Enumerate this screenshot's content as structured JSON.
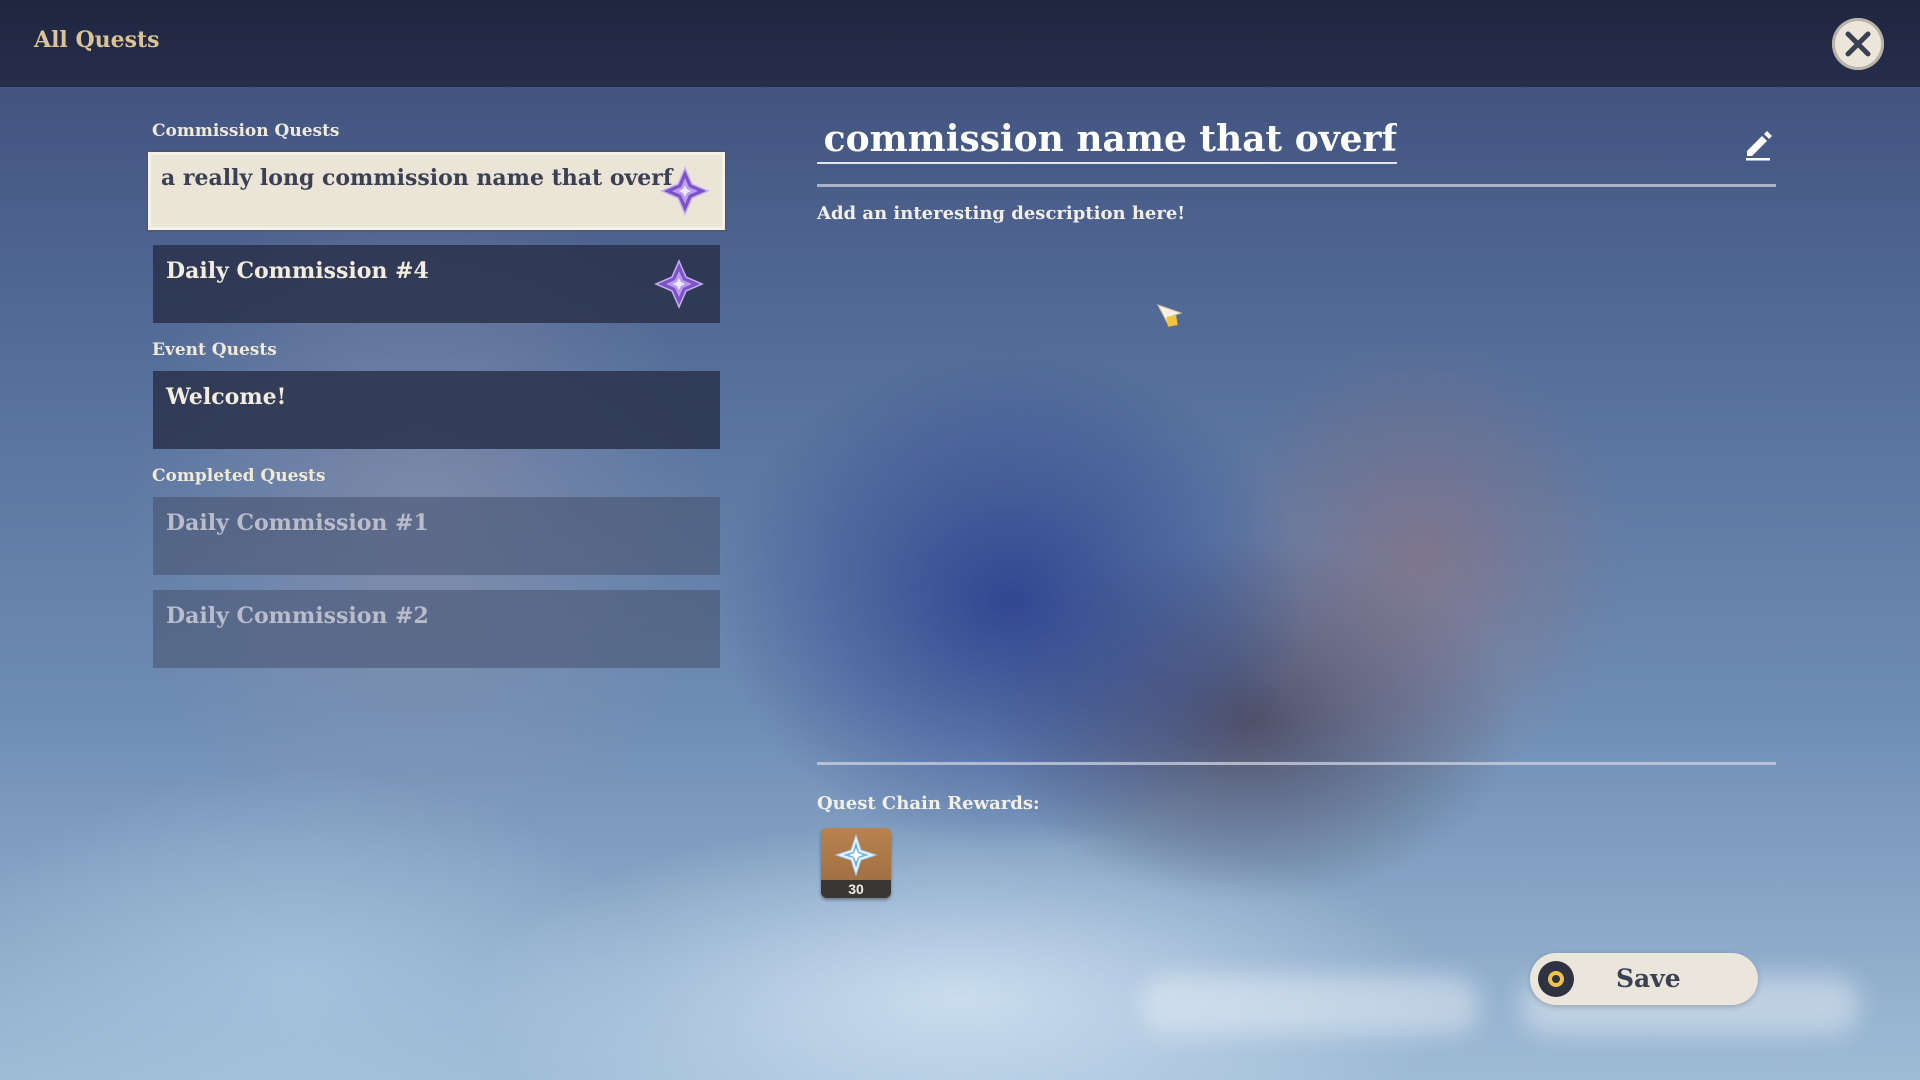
{
  "header": {
    "title": "All Quests",
    "close_icon": "close-icon"
  },
  "sections": {
    "commission_label": "Commission Quests",
    "event_label": "Event Quests",
    "completed_label": "Completed Quests"
  },
  "commission_quests": [
    {
      "name": "a really long commission name that overf",
      "selected": true,
      "icon": "commission-diamond-icon"
    },
    {
      "name": "Daily Commission #4",
      "selected": false,
      "icon": "commission-diamond-icon"
    }
  ],
  "event_quests": [
    {
      "name": "Welcome!"
    }
  ],
  "completed_quests": [
    {
      "name": "Daily Commission #1"
    },
    {
      "name": "Daily Commission #2"
    }
  ],
  "detail": {
    "title": "a really long commission name that overf",
    "edit_icon": "pencil-icon",
    "description": "Add an interesting description here!",
    "rewards_label": "Quest Chain Rewards:",
    "rewards": [
      {
        "item": "primogem-icon",
        "quantity": "30"
      }
    ]
  },
  "footer": {
    "save_label": "Save"
  },
  "colors": {
    "header_bg": "#262e4a",
    "header_title": "#d9c397",
    "selected_card_bg": "#ebe5d8",
    "card_bg": "#28304b",
    "accent_gold": "#f0c24a",
    "diamond_purple": "#8a5fd0"
  }
}
